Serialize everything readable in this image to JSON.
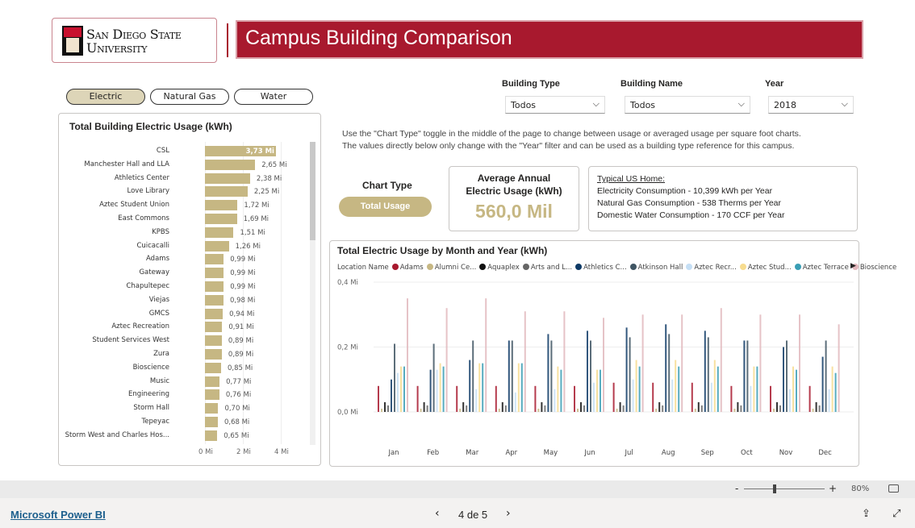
{
  "header": {
    "logo_line1": "San Diego State",
    "logo_line2": "University",
    "title": "Campus Building Comparison"
  },
  "toggles": [
    {
      "label": "Electric",
      "active": true
    },
    {
      "label": "Natural Gas",
      "active": false
    },
    {
      "label": "Water",
      "active": false
    }
  ],
  "filters": [
    {
      "label": "Building Type",
      "value": "Todos"
    },
    {
      "label": "Building Name",
      "value": "Todos"
    },
    {
      "label": "Year",
      "value": "2018"
    }
  ],
  "note_line1": "Use the \"Chart Type\" toggle in the middle of the page to change between usage or averaged usage per square foot charts.",
  "note_line2": "The values directly below only change with the \"Year\" filter and can be used as a building type reference for this campus.",
  "chart_type": {
    "label": "Chart Type",
    "button": "Total Usage"
  },
  "kpi": {
    "label": "Average Annual Electric Usage (kWh)",
    "value": "560,0 Mil"
  },
  "typical": {
    "title": "Typical US Home:",
    "lines": [
      "Electricity Consumption - 10,399 kWh per Year",
      "Natural Gas Consumption - 538 Therms per Year",
      "Domestic Water Consumption - 170 CCF per Year"
    ]
  },
  "colors": {
    "accent": "#a8192e",
    "gold": "#c6b783"
  },
  "chart_data": [
    {
      "type": "bar",
      "orientation": "horizontal",
      "title": "Total Building Electric Usage (kWh)",
      "xlim": [
        0,
        4
      ],
      "xticks": [
        "0 Mi",
        "2 Mi",
        "4 Mi"
      ],
      "categories": [
        "CSL",
        "Manchester Hall and LLA",
        "Athletics Center",
        "Love Library",
        "Aztec Student Union",
        "East Commons",
        "KPBS",
        "Cuicacalli",
        "Adams",
        "Gateway",
        "Chapultepec",
        "Viejas",
        "GMCS",
        "Aztec Recreation",
        "Student Services West",
        "Zura",
        "Bioscience",
        "Music",
        "Engineering",
        "Storm Hall",
        "Tepeyac",
        "Storm West and Charles Hos..."
      ],
      "values": [
        3.73,
        2.65,
        2.38,
        2.25,
        1.72,
        1.69,
        1.51,
        1.26,
        0.99,
        0.99,
        0.99,
        0.98,
        0.94,
        0.91,
        0.89,
        0.89,
        0.85,
        0.77,
        0.76,
        0.7,
        0.68,
        0.65
      ],
      "labels": [
        "3,73 Mi",
        "2,65 Mi",
        "2,38 Mi",
        "2,25 Mi",
        "1,72 Mi",
        "1,69 Mi",
        "1,51 Mi",
        "1,26 Mi",
        "0,99 Mi",
        "0,99 Mi",
        "0,99 Mi",
        "0,98 Mi",
        "0,94 Mi",
        "0,91 Mi",
        "0,89 Mi",
        "0,89 Mi",
        "0,85 Mi",
        "0,77 Mi",
        "0,76 Mi",
        "0,70 Mi",
        "0,68 Mi",
        "0,65 Mi"
      ]
    },
    {
      "type": "bar",
      "title": "Total Electric Usage by Month and Year (kWh)",
      "legend_title": "Location Name",
      "legend_position": "top",
      "categories": [
        "Jan",
        "Feb",
        "Mar",
        "Apr",
        "May",
        "Jun",
        "Jul",
        "Aug",
        "Sep",
        "Oct",
        "Nov",
        "Dec"
      ],
      "ylim": [
        0,
        0.4
      ],
      "yticks": [
        "0,0 Mi",
        "0,2 Mi",
        "0,4 Mi"
      ],
      "grid": true,
      "series": [
        {
          "name": "Adams",
          "color": "#a8192e",
          "values": [
            0.08,
            0.08,
            0.08,
            0.08,
            0.08,
            0.08,
            0.09,
            0.09,
            0.09,
            0.08,
            0.08,
            0.08
          ]
        },
        {
          "name": "Alumni Ce...",
          "color": "#c6b783",
          "values": [
            0.01,
            0.01,
            0.01,
            0.01,
            0.01,
            0.01,
            0.01,
            0.01,
            0.01,
            0.01,
            0.01,
            0.01
          ]
        },
        {
          "name": "Aquaplex",
          "color": "#111111",
          "values": [
            0.03,
            0.03,
            0.03,
            0.03,
            0.03,
            0.03,
            0.03,
            0.03,
            0.03,
            0.03,
            0.03,
            0.03
          ]
        },
        {
          "name": "Arts and L...",
          "color": "#666666",
          "values": [
            0.02,
            0.02,
            0.02,
            0.02,
            0.02,
            0.02,
            0.02,
            0.02,
            0.02,
            0.02,
            0.02,
            0.02
          ]
        },
        {
          "name": "Athletics C...",
          "color": "#0e3a66",
          "values": [
            0.1,
            0.13,
            0.16,
            0.22,
            0.24,
            0.25,
            0.26,
            0.27,
            0.25,
            0.22,
            0.2,
            0.17
          ]
        },
        {
          "name": "Atkinson Hall",
          "color": "#3f5563",
          "values": [
            0.21,
            0.21,
            0.22,
            0.22,
            0.22,
            0.22,
            0.23,
            0.24,
            0.23,
            0.22,
            0.22,
            0.22
          ]
        },
        {
          "name": "Aztec Recr...",
          "color": "#c5dff5",
          "values": [
            0.12,
            0.13,
            0.07,
            0.06,
            0.07,
            0.09,
            0.1,
            0.1,
            0.09,
            0.08,
            0.07,
            0.07
          ]
        },
        {
          "name": "Aztec Stud...",
          "color": "#f7dc8f",
          "values": [
            0.14,
            0.15,
            0.15,
            0.15,
            0.14,
            0.13,
            0.16,
            0.16,
            0.16,
            0.14,
            0.14,
            0.14
          ]
        },
        {
          "name": "Aztec Terrace",
          "color": "#3a9eb5",
          "values": [
            0.14,
            0.14,
            0.15,
            0.15,
            0.13,
            0.13,
            0.14,
            0.14,
            0.14,
            0.14,
            0.13,
            0.12
          ]
        },
        {
          "name": "Bioscience",
          "color": "#e2b8bd",
          "values": [
            0.35,
            0.32,
            0.35,
            0.31,
            0.31,
            0.29,
            0.3,
            0.3,
            0.32,
            0.3,
            0.3,
            0.27
          ]
        }
      ]
    }
  ],
  "footer": {
    "zoom": "80%",
    "zoom_level": 0.5,
    "brand": "Microsoft Power BI",
    "page": "4 de 5"
  }
}
